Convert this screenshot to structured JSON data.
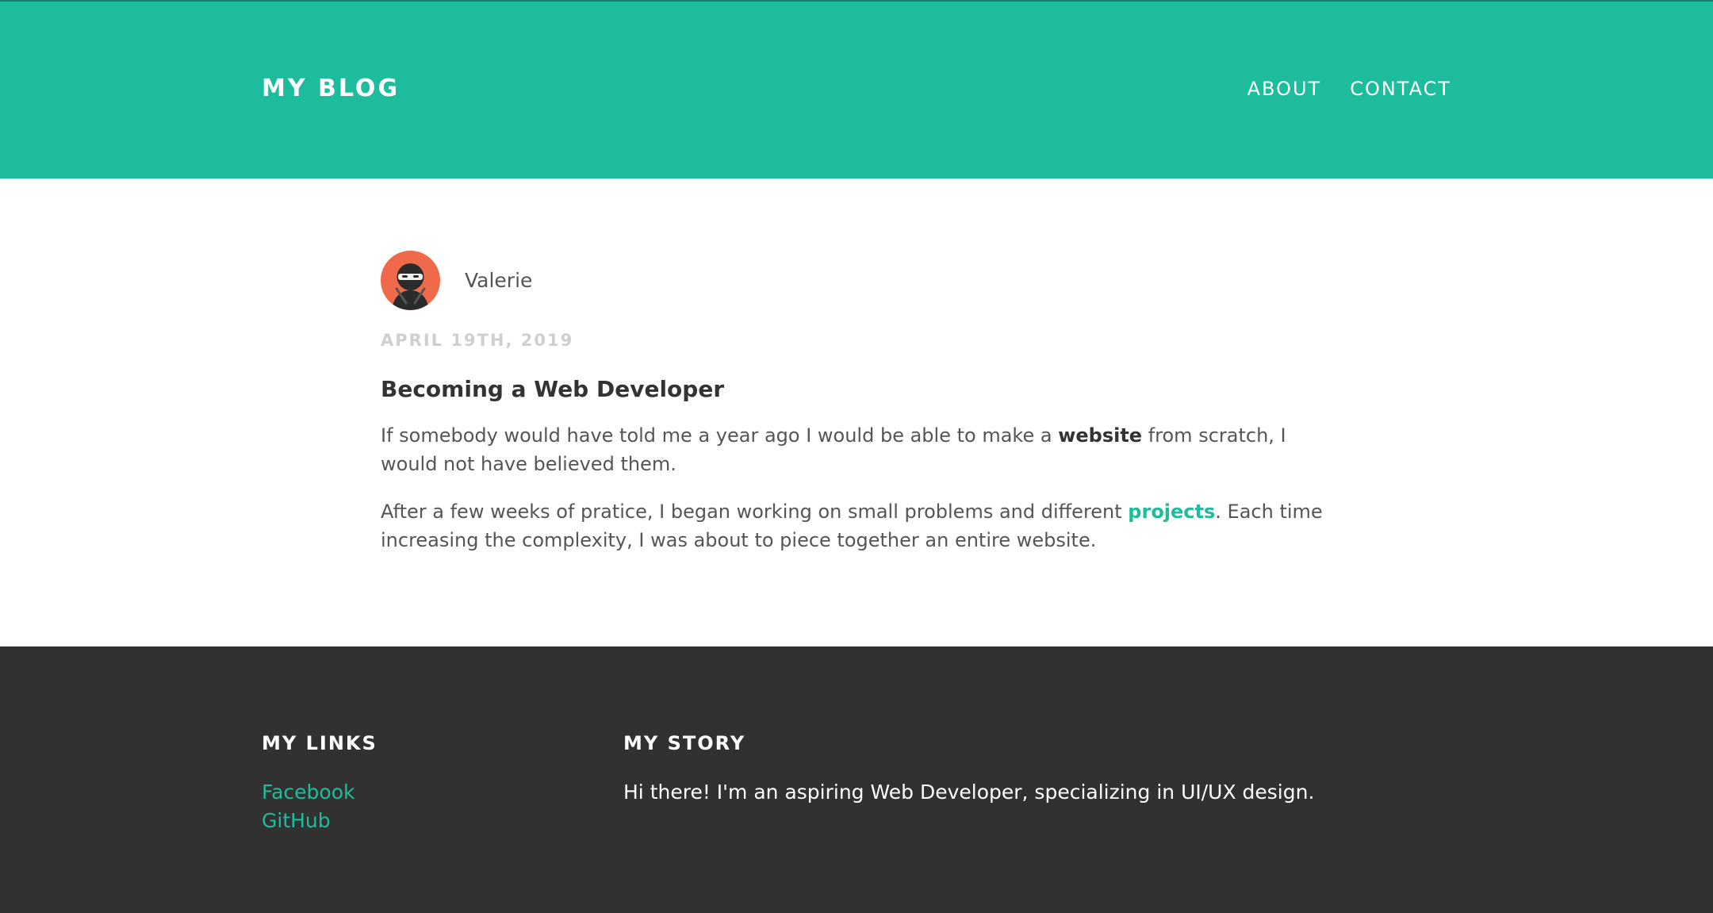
{
  "colors": {
    "accent": "#1dbc9c",
    "footer_bg": "#313131",
    "avatar_bg": "#ef6a4b"
  },
  "header": {
    "brand": "MY BLOG",
    "nav": [
      {
        "label": "ABOUT"
      },
      {
        "label": "CONTACT"
      }
    ]
  },
  "post": {
    "author": {
      "name": "Valerie",
      "avatar_icon": "ninja-avatar-icon"
    },
    "date": "APRIL 19TH, 2019",
    "title": "Becoming a Web Developer",
    "paragraphs": [
      {
        "before": "If somebody would have told me a year ago I would be able to make a ",
        "emphasis": "website",
        "after": " from scratch, I would not have believed them."
      },
      {
        "before": "After a few weeks of pratice, I began working on small problems and different ",
        "link": "projects",
        "after": ". Each time increasing the complexity, I was about to piece together an entire website."
      }
    ]
  },
  "footer": {
    "links_heading": "MY LINKS",
    "links": [
      {
        "label": "Facebook"
      },
      {
        "label": "GitHub"
      }
    ],
    "story_heading": "MY STORY",
    "story_text": "Hi there! I'm an aspiring Web Developer, specializing in UI/UX design."
  }
}
